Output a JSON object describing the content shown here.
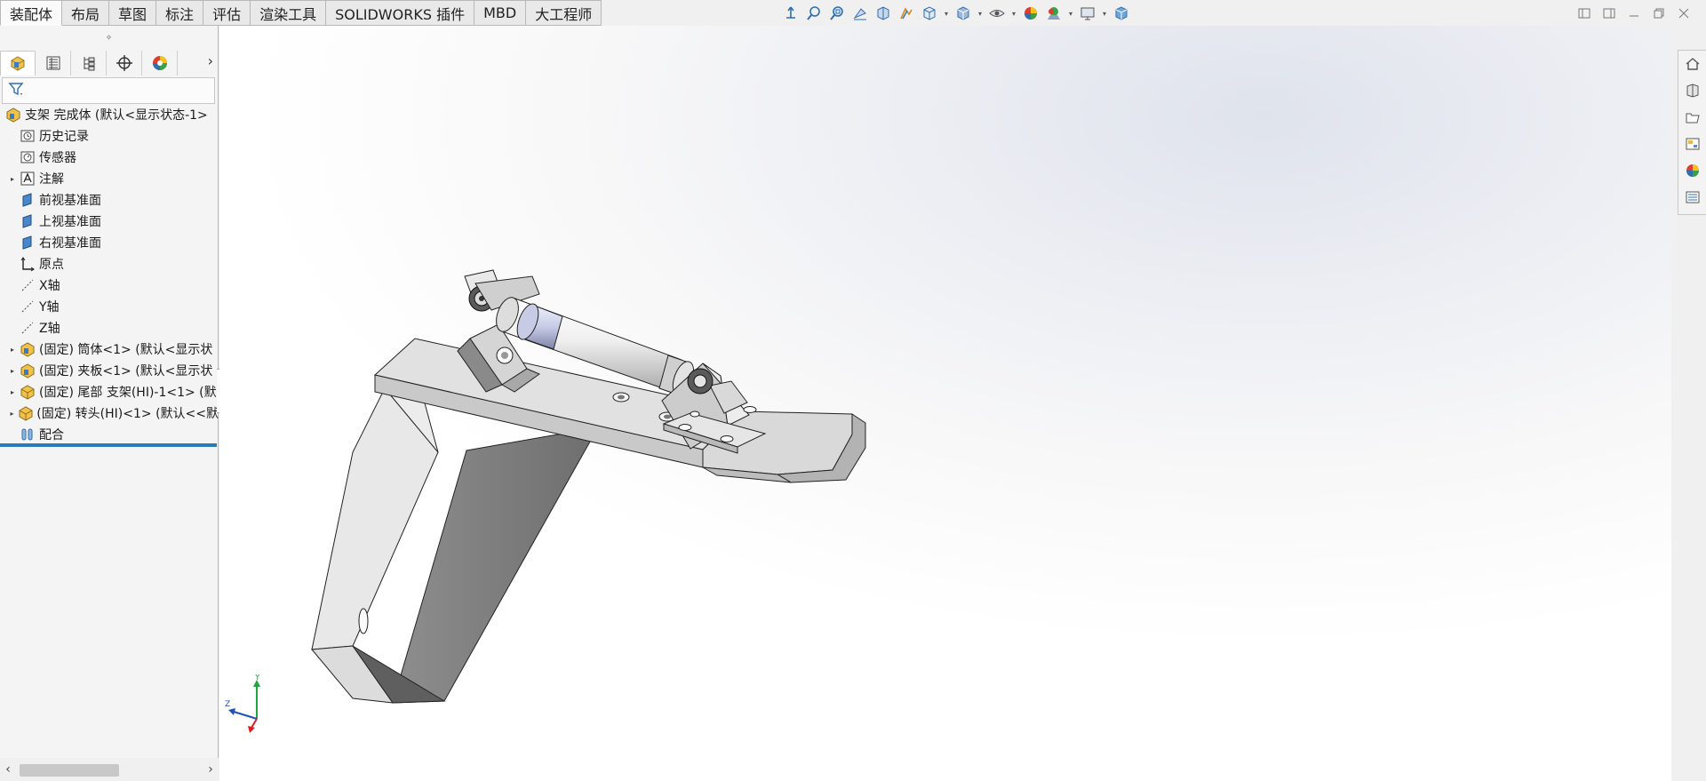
{
  "tabs": [
    {
      "label": "装配体",
      "active": true
    },
    {
      "label": "布局"
    },
    {
      "label": "草图"
    },
    {
      "label": "标注"
    },
    {
      "label": "评估"
    },
    {
      "label": "渲染工具"
    },
    {
      "label": "SOLIDWORKS 插件"
    },
    {
      "label": "MBD"
    },
    {
      "label": "大工程师"
    }
  ],
  "hud_icons": [
    "view-orientation-icon",
    "zoom-to-fit-icon",
    "zoom-area-icon",
    "previous-view-icon",
    "section-view-icon",
    "dynamic-annotation-icon",
    "view-orientation-dropdown-icon",
    "display-style-icon",
    "hide-show-items-icon",
    "edit-appearance-icon",
    "apply-scene-icon",
    "view-settings-icon",
    "cube-icon"
  ],
  "window_controls": [
    "tile-left",
    "tile-right",
    "minimize",
    "restore",
    "close"
  ],
  "panel": {
    "grip": "⋄",
    "filter_icon": "filter-icon",
    "tabs": [
      "feature-manager-icon",
      "property-manager-icon",
      "configuration-manager-icon",
      "dimxpert-icon",
      "display-manager-icon"
    ],
    "more": "›",
    "tree": [
      {
        "label": "支架 完成体  (默认<显示状态-1>",
        "icon": "assembly-icon",
        "indent": 0,
        "expander": ""
      },
      {
        "label": "历史记录",
        "icon": "history-icon",
        "indent": 1,
        "expander": ""
      },
      {
        "label": "传感器",
        "icon": "sensor-icon",
        "indent": 1,
        "expander": ""
      },
      {
        "label": "注解",
        "icon": "annotation-icon",
        "indent": 1,
        "expander": "▸"
      },
      {
        "label": "前视基准面",
        "icon": "plane-icon",
        "indent": 1,
        "expander": ""
      },
      {
        "label": "上视基准面",
        "icon": "plane-icon",
        "indent": 1,
        "expander": ""
      },
      {
        "label": "右视基准面",
        "icon": "plane-icon",
        "indent": 1,
        "expander": ""
      },
      {
        "label": "原点",
        "icon": "origin-icon",
        "indent": 1,
        "expander": ""
      },
      {
        "label": "X轴",
        "icon": "axis-icon",
        "indent": 1,
        "expander": ""
      },
      {
        "label": "Y轴",
        "icon": "axis-icon",
        "indent": 1,
        "expander": ""
      },
      {
        "label": "Z轴",
        "icon": "axis-icon",
        "indent": 1,
        "expander": ""
      },
      {
        "label": "(固定) 筒体<1> (默认<显示状",
        "icon": "subassembly-icon",
        "indent": 1,
        "expander": "▸"
      },
      {
        "label": "(固定) 夹板<1> (默认<显示状",
        "icon": "subassembly-icon",
        "indent": 1,
        "expander": "▸"
      },
      {
        "label": "(固定) 尾部 支架(HI)-1<1> (默",
        "icon": "part-icon",
        "indent": 1,
        "expander": "▸"
      },
      {
        "label": "(固定) 转头(HI)<1> (默认<<默",
        "icon": "part-icon",
        "indent": 1,
        "expander": "▸"
      },
      {
        "label": "配合",
        "icon": "mates-icon",
        "indent": 1,
        "expander": ""
      }
    ],
    "scroll": {
      "left": "‹",
      "right": "›"
    }
  },
  "triad": {
    "x": "Z",
    "y": "Y"
  },
  "taskpane_icons": [
    "solidworks-resources-icon",
    "design-library-icon",
    "file-explorer-icon",
    "view-palette-icon",
    "appearances-scenes-icon",
    "custom-properties-icon"
  ]
}
